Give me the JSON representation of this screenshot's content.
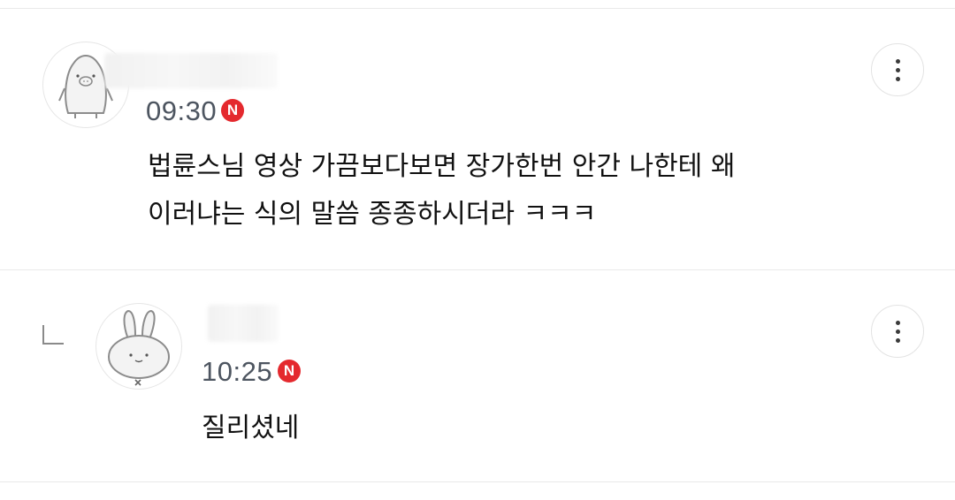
{
  "comments": [
    {
      "time": "09:30",
      "badge": "N",
      "text": "법륜스님 영상 가끔보다보면 장가한번 안간 나한테 왜\n이러냐는 식의 말씀 종종하시더라 ㅋㅋㅋ",
      "avatar_icon": "penguin-avatar-icon"
    },
    {
      "time": "10:25",
      "badge": "N",
      "text": "질리셨네",
      "avatar_icon": "rabbit-avatar-icon",
      "is_reply": true
    }
  ],
  "icons": {
    "more": "more-vertical-icon",
    "reply": "reply-arrow-icon"
  }
}
